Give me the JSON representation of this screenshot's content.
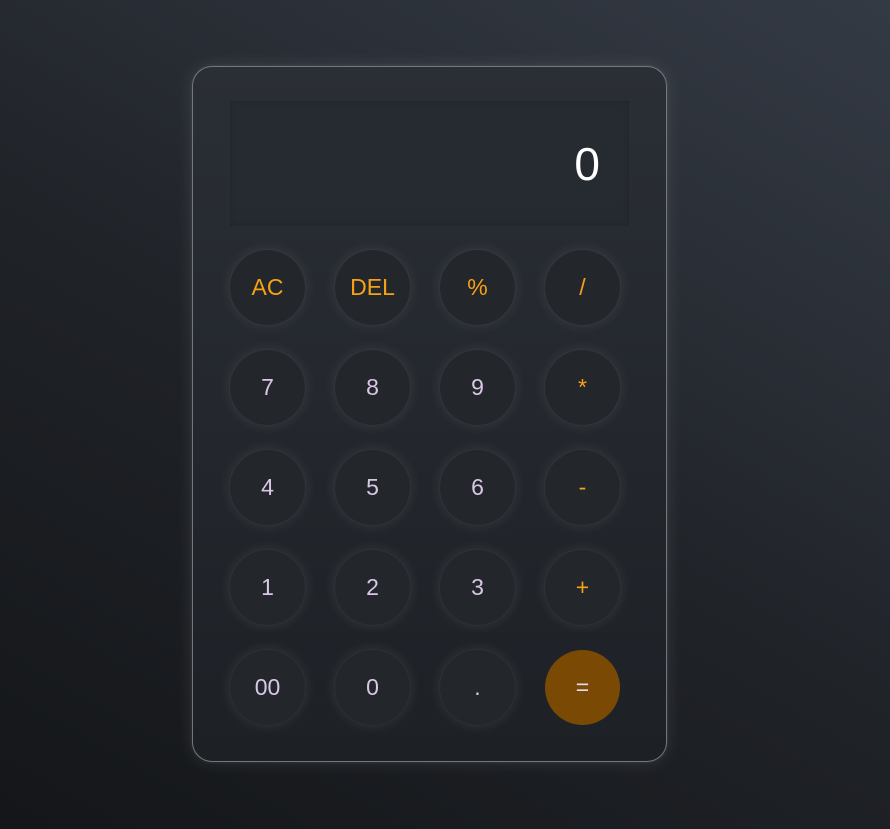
{
  "display": {
    "value": "0"
  },
  "keys": {
    "ac": "AC",
    "del": "DEL",
    "percent": "%",
    "divide": "/",
    "seven": "7",
    "eight": "8",
    "nine": "9",
    "multiply": "*",
    "four": "4",
    "five": "5",
    "six": "6",
    "subtract": "-",
    "one": "1",
    "two": "2",
    "three": "3",
    "add": "+",
    "double_zero": "00",
    "zero": "0",
    "decimal": ".",
    "equals": "="
  },
  "colors": {
    "accent": "#f5a214",
    "digit": "#d9c7e6",
    "equals_bg": "#7a4a05",
    "display_text": "#ffffff"
  }
}
